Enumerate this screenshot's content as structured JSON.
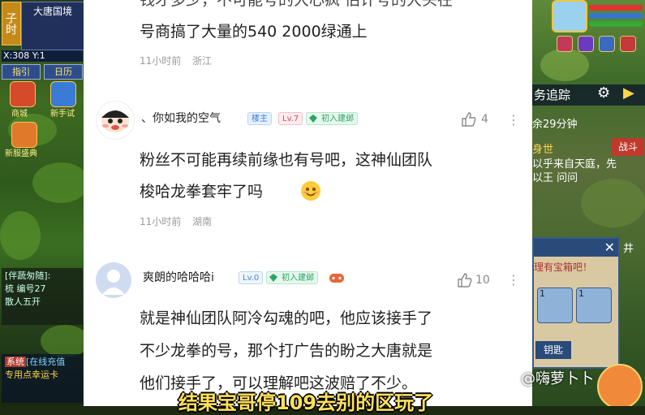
{
  "left_hud": {
    "time_label": "子时",
    "map_name": "大唐国境",
    "coords": "X:308 Y:1",
    "buttons": [
      "指引",
      "日历"
    ],
    "icon_labels": [
      "商城",
      "新手试",
      "新服盛典"
    ],
    "team_line1": "[伴蔬匆随]:",
    "team_line2": "梳 编号27",
    "team_line3": "散人五开",
    "system_tag": "系统",
    "system_link": "[在线充值",
    "system_line": "专用点幸运卡"
  },
  "right_hud": {
    "task_title": "务追踪",
    "countdown": "余29分钟",
    "battle_label": "战斗",
    "npc_lines": [
      "身世",
      "以乎来自天庭，先",
      "以王 问问"
    ],
    "side_label": "井",
    "chest_title": "理有宝箱吧！",
    "chest_count1": "1",
    "chest_count2": "1",
    "chest_button": "钥匙"
  },
  "comments": [
    {
      "text_lines": [
        "钱才多少，不可能号的大心疯 估计号的大头在",
        "号商搞了大量的540 2000绿通上"
      ],
      "time": "11小时前",
      "location": "浙江"
    },
    {
      "username": "、你如我的空气",
      "badges": [
        "楼主",
        "Lv.7",
        "初入建邺"
      ],
      "likes": "4",
      "text_lines": [
        "粉丝不可能再续前缘也有号吧，这神仙团队",
        "梭哈龙拳套牢了吗"
      ],
      "time": "11小时前",
      "location": "湖南"
    },
    {
      "username": "爽朗的哈哈哈i",
      "badges": [
        "Lv.0",
        "初入建邺"
      ],
      "likes": "10",
      "text_lines": [
        "就是神仙团队阿冷勾魂的吧，他应该接手了",
        "不少龙拳的号，那个打广告的盼之大唐就是",
        "他们接手了，可以理解吧这波赔了不少。"
      ]
    }
  ],
  "subtitle": "结果宝哥停109去别的区玩了",
  "watermark": "@嗨萝卜卜",
  "colors": {
    "panel_bg": "#ffffff",
    "subtitle": "#ffe15a",
    "fan_badge": "#2aa55f",
    "host_badge": "#3b7ddd"
  }
}
